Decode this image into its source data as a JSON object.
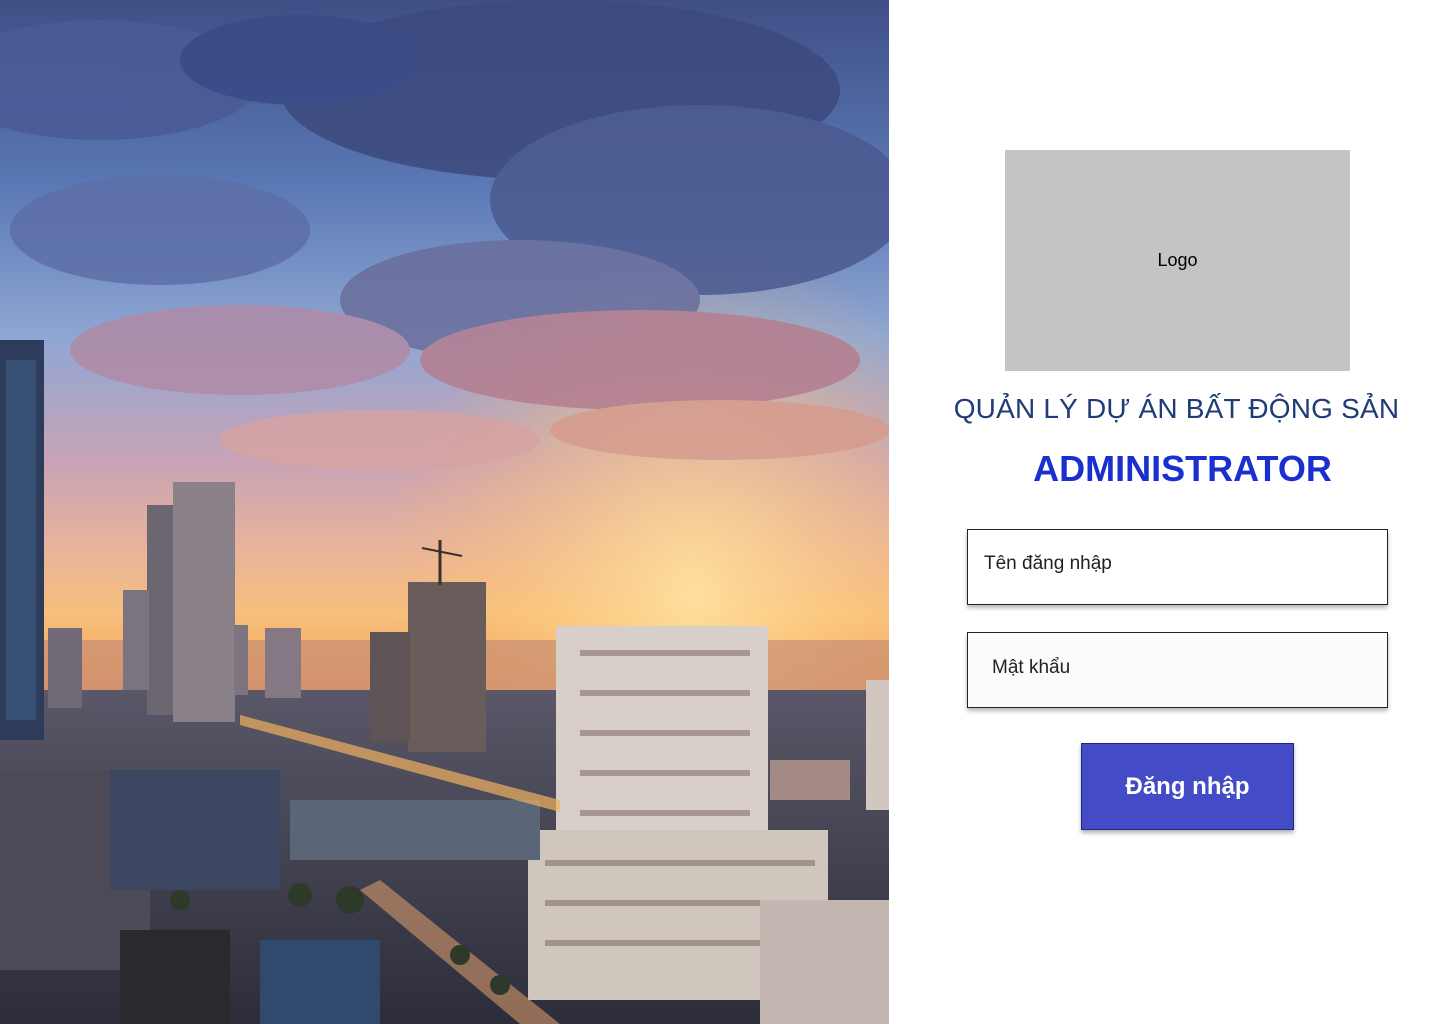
{
  "hero": {
    "image": "city-skyline-sunset-photo"
  },
  "logo": {
    "label": "Logo"
  },
  "header": {
    "subtitle": "QUẢN LÝ DỰ ÁN BẤT ĐỘNG SẢN",
    "title": "ADMINISTRATOR"
  },
  "form": {
    "username_placeholder": "Tên đăng nhập",
    "password_placeholder": "Mật khẩu",
    "submit_label": "Đăng nhập"
  },
  "colors": {
    "title": "#1a2fd0",
    "subtitle": "#1f3b78",
    "button": "#434cc6",
    "logo_placeholder": "#c4c4c4"
  }
}
